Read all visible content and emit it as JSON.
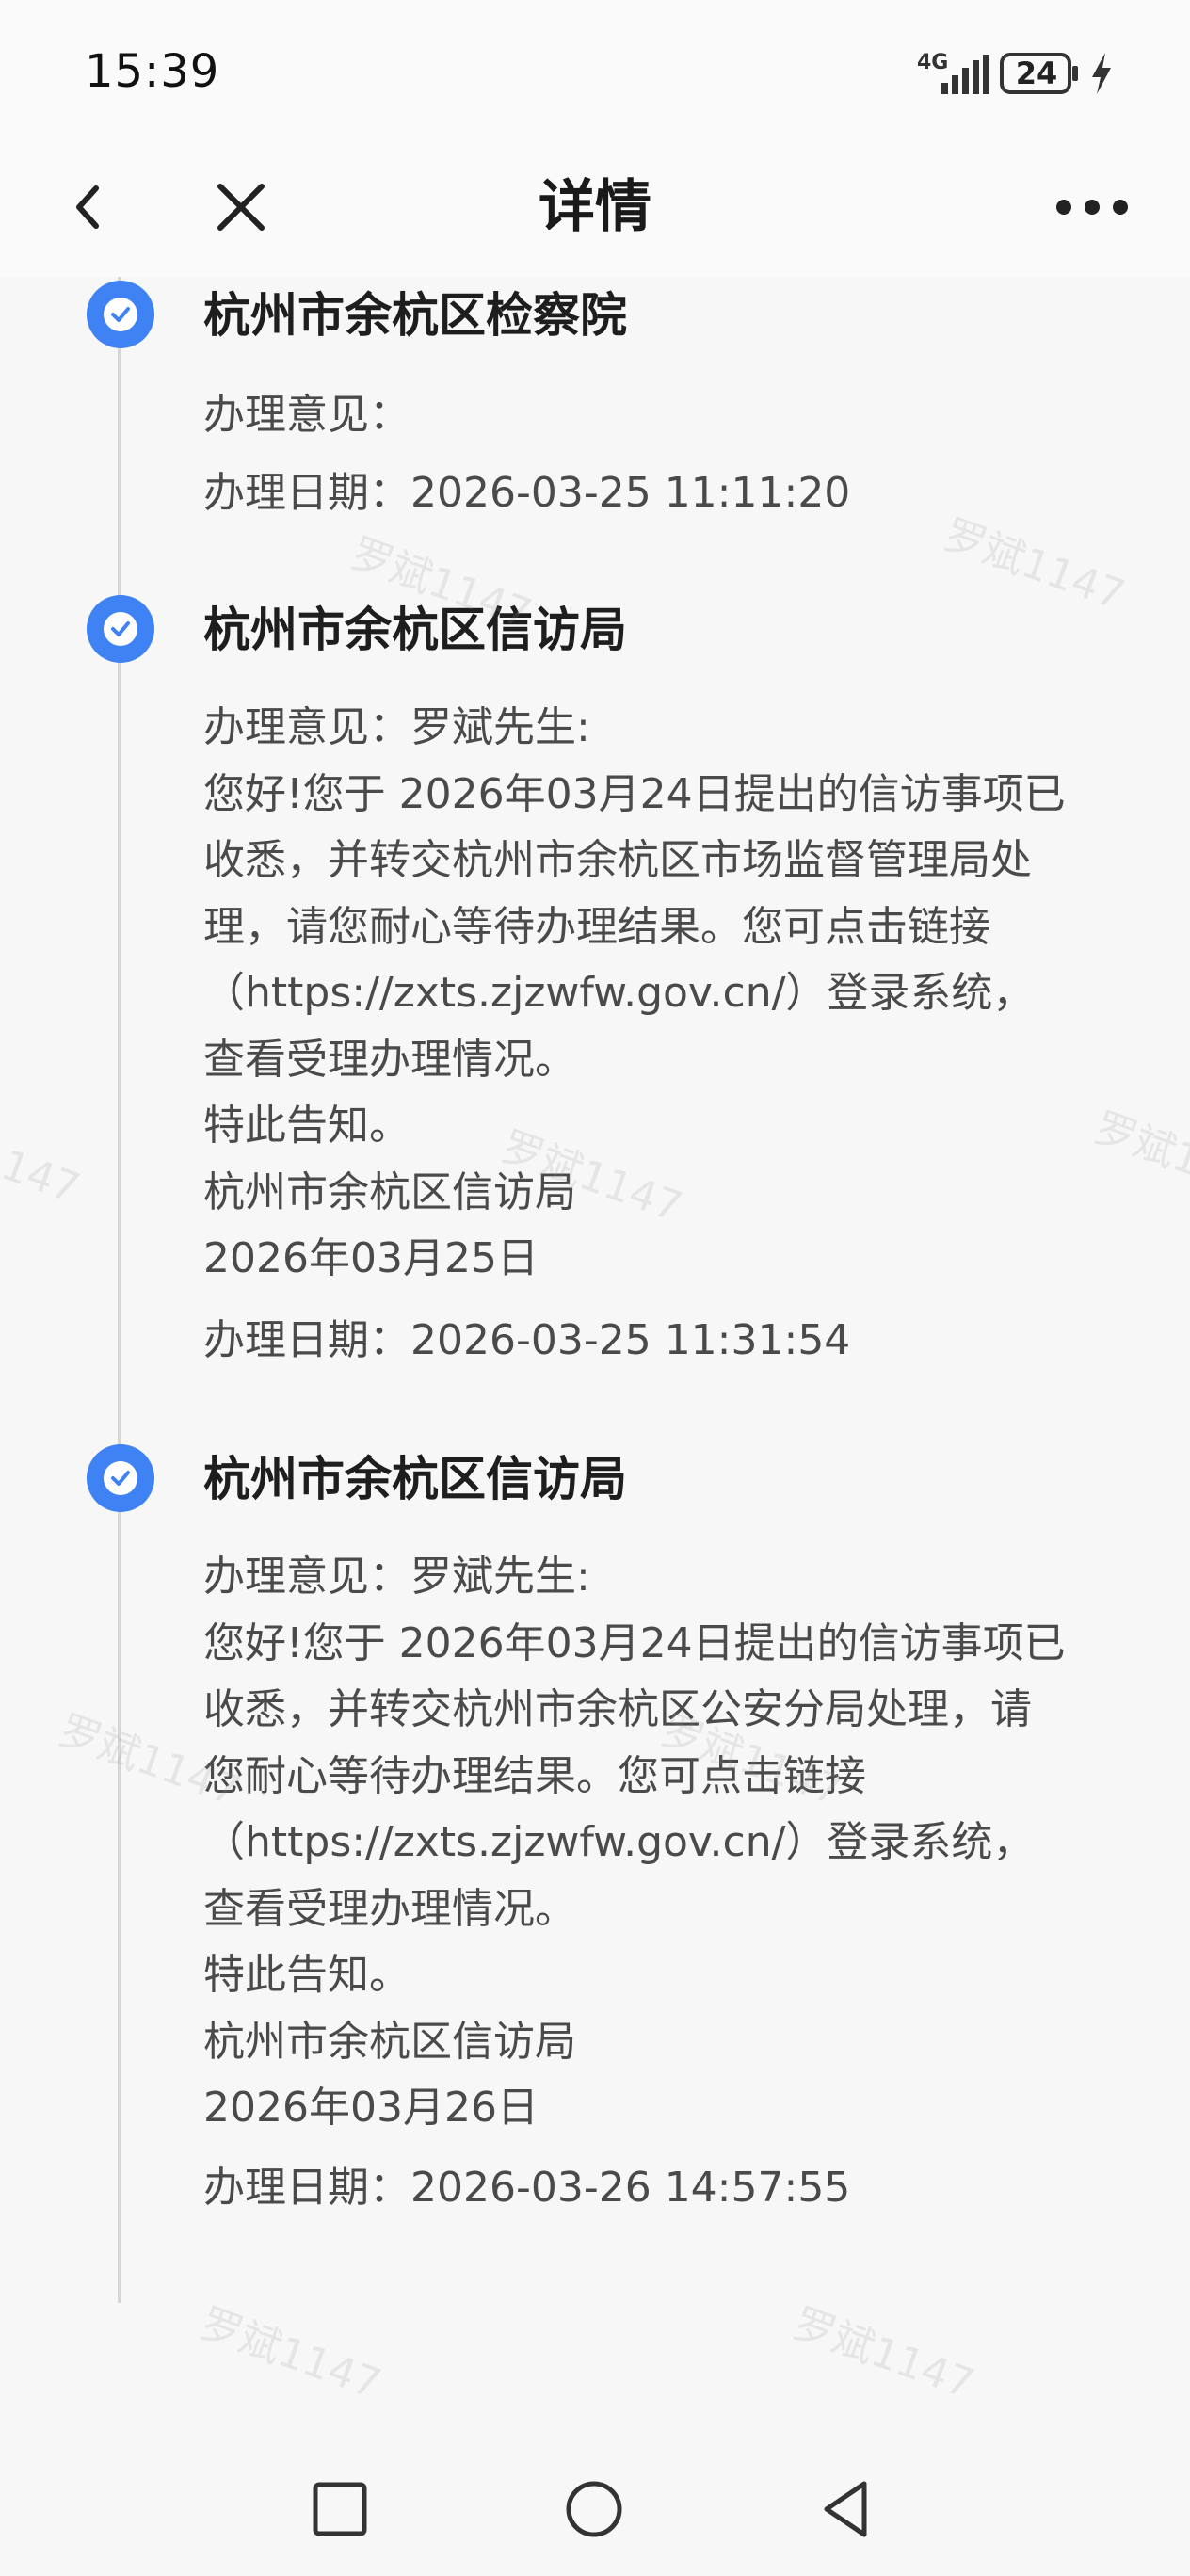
{
  "status_bar": {
    "time": "15:39",
    "network": "4G",
    "battery": "24",
    "icons": [
      "signal-icon",
      "battery-icon",
      "charging-icon"
    ]
  },
  "app_bar": {
    "title": "详情",
    "icons": [
      "back-chevron-icon",
      "close-icon",
      "more-icon"
    ]
  },
  "entries": [
    {
      "org": "杭州市余杭区检察院",
      "lines": [
        "办理意见："
      ],
      "date": "办理日期：2026-03-25 11:11:20"
    },
    {
      "org": "杭州市余杭区信访局",
      "lines": [
        "办理意见：罗斌先生:",
        "您好!您于 2026年03月24日提出的信访事项已",
        "收悉，并转交杭州市余杭区市场监督管理局处",
        "理，请您耐心等待办理结果。您可点击链接",
        "（https://zxts.zjzwfw.gov.cn/）登录系统，",
        "查看受理办理情况。",
        "特此告知。",
        "杭州市余杭区信访局",
        "2026年03月25日"
      ],
      "date": "办理日期：2026-03-25 11:31:54"
    },
    {
      "org": "杭州市余杭区信访局",
      "lines": [
        "办理意见：罗斌先生:",
        "您好!您于 2026年03月24日提出的信访事项已",
        "收悉，并转交杭州市余杭区公安分局处理，请",
        "您耐心等待办理结果。您可点击链接",
        "（https://zxts.zjzwfw.gov.cn/）登录系统，",
        "查看受理办理情况。",
        "特此告知。",
        "杭州市余杭区信访局",
        "2026年03月26日"
      ],
      "date": "办理日期：2026-03-26 14:57:55"
    }
  ],
  "watermark": "罗斌1147",
  "nav_bar": {
    "icons": [
      "recent-apps-icon",
      "home-icon",
      "back-triangle-icon"
    ]
  },
  "colors": {
    "accent": "#3e82f3",
    "background": "#f7f7f7",
    "title_text": "#1e1e1e",
    "body_text": "#4a4a4a"
  }
}
